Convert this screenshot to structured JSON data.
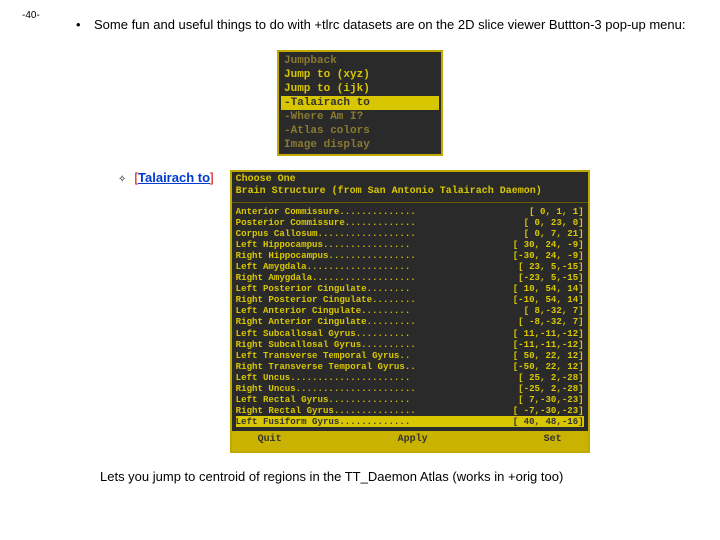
{
  "page_number": "-40-",
  "intro": {
    "bullet_glyph": "•",
    "text": "Some fun and useful things to do with +tlrc datasets are on the 2D slice viewer Buttton-3 pop-up menu:"
  },
  "popup_menu": {
    "items": [
      {
        "label": "Jumpback",
        "highlight": false,
        "dim": true
      },
      {
        "label": "Jump to (xyz)",
        "highlight": false,
        "dim": false
      },
      {
        "label": "Jump to (ijk)",
        "highlight": false,
        "dim": false
      },
      {
        "label": "-Talairach to",
        "highlight": true,
        "dim": false
      },
      {
        "label": "-Where Am I?",
        "highlight": false,
        "dim": true
      },
      {
        "label": "-Atlas colors",
        "highlight": false,
        "dim": true
      },
      {
        "label": "Image display",
        "highlight": false,
        "dim": true
      }
    ]
  },
  "section": {
    "diamond": "✧",
    "bracket_open": "[",
    "link_text": "Talairach to",
    "bracket_close": "]"
  },
  "tt_window": {
    "header_line1": "Choose One",
    "header_line2": "Brain Structure (from San Antonio Talairach Daemon)",
    "rows": [
      {
        "name": "Anterior Commissure..............",
        "coord": "[  0,  1,  1]",
        "hi": false
      },
      {
        "name": "Posterior Commissure.............",
        "coord": "[  0, 23,  0]",
        "hi": false
      },
      {
        "name": "Corpus Callosum..................",
        "coord": "[  0,  7, 21]",
        "hi": false
      },
      {
        "name": "Left  Hippocampus................",
        "coord": "[ 30, 24, -9]",
        "hi": false
      },
      {
        "name": "Right Hippocampus................",
        "coord": "[-30, 24, -9]",
        "hi": false
      },
      {
        "name": "Left  Amygdala...................",
        "coord": "[ 23,  5,-15]",
        "hi": false
      },
      {
        "name": "Right Amygdala...................",
        "coord": "[-23,  5,-15]",
        "hi": false
      },
      {
        "name": "Left  Posterior Cingulate........",
        "coord": "[ 10, 54, 14]",
        "hi": false
      },
      {
        "name": "Right Posterior Cingulate........",
        "coord": "[-10, 54, 14]",
        "hi": false
      },
      {
        "name": "Left  Anterior Cingulate.........",
        "coord": "[  8,-32,  7]",
        "hi": false
      },
      {
        "name": "Right Anterior Cingulate.........",
        "coord": "[ -8,-32,  7]",
        "hi": false
      },
      {
        "name": "Left  Subcallosal Gyrus..........",
        "coord": "[ 11,-11,-12]",
        "hi": false
      },
      {
        "name": "Right Subcallosal Gyrus..........",
        "coord": "[-11,-11,-12]",
        "hi": false
      },
      {
        "name": "Left  Transverse Temporal Gyrus..",
        "coord": "[ 50, 22, 12]",
        "hi": false
      },
      {
        "name": "Right Transverse Temporal Gyrus..",
        "coord": "[-50, 22, 12]",
        "hi": false
      },
      {
        "name": "Left  Uncus......................",
        "coord": "[ 25,  2,-28]",
        "hi": false
      },
      {
        "name": "Right Uncus......................",
        "coord": "[-25,  2,-28]",
        "hi": false
      },
      {
        "name": "Left  Rectal Gyrus...............",
        "coord": "[  7,-30,-23]",
        "hi": false
      },
      {
        "name": "Right Rectal Gyrus...............",
        "coord": "[ -7,-30,-23]",
        "hi": false
      },
      {
        "name": "Left  Fusiform Gyrus.............",
        "coord": "[ 40, 48,-16]",
        "hi": true
      }
    ],
    "buttons": {
      "quit": "Quit",
      "apply": "Apply",
      "set": "Set"
    }
  },
  "footer": "Lets you jump to centroid of regions in the TT_Daemon Atlas (works in +orig too)"
}
